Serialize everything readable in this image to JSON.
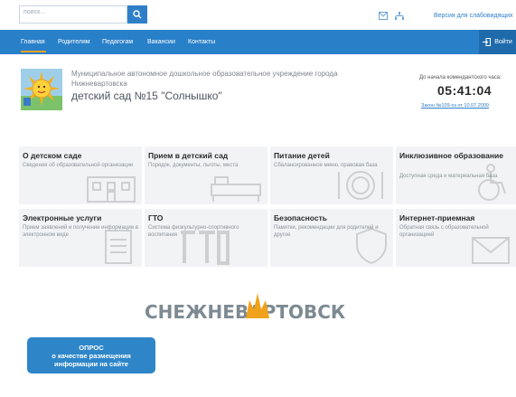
{
  "topbar": {
    "search_placeholder": "поиск...",
    "vision_link": "Версия для слабовидящих"
  },
  "nav": {
    "items": [
      "Главная",
      "Родителям",
      "Педагогам",
      "Вакансии",
      "Контакты"
    ],
    "active_index": 0,
    "login_label": "Войти"
  },
  "header": {
    "org_line1": "Муниципальное автономное дошкольное образовательное учреждение города",
    "org_line2": "Нижневартовска",
    "org_title": "детский сад №15 \"Солнышко\"",
    "curfew_label": "До начала комендантского часа:",
    "curfew_time": "05:41:04",
    "curfew_law": "Закон №109-оз от 10.07.2009"
  },
  "tiles": [
    {
      "title": "О детском саде",
      "desc": "Сведения об образовательной организации",
      "icon": "building-icon"
    },
    {
      "title": "Прием в детский сад",
      "desc": "Порядок, документы, льготы, места",
      "icon": "bed-icon"
    },
    {
      "title": "Питание детей",
      "desc": "Сбалансированное меню, правовая база",
      "icon": "plate-icon"
    },
    {
      "title": "Инклюзивное образование",
      "desc": "Доступная среда и материальная база",
      "icon": "wheelchair-icon"
    },
    {
      "title": "Электронные услуги",
      "desc": "Прием заявлений и получение информации в электронном виде",
      "icon": "document-icon"
    },
    {
      "title": "ГТО",
      "desc": "Система физкультурно-спортивного воспитания",
      "icon": "gto-icon"
    },
    {
      "title": "Безопасность",
      "desc": "Памятки, рекомендации для родителей и другое",
      "icon": "shield-icon"
    },
    {
      "title": "Интернет-приемная",
      "desc": "Обратная связь с образовательной организацией",
      "icon": "envelope-icon"
    }
  ],
  "banners": {
    "city_logo_text": "СНЕЖНЕВАРТОВСК",
    "survey": [
      "ОПРОС",
      "о качестве размещения",
      "информации на сайте"
    ]
  },
  "colors": {
    "nav_bg": "#2880c8",
    "accent": "#f0a21b",
    "tile_bg": "#f1f3f5",
    "survey_bg": "#2e86c9"
  }
}
